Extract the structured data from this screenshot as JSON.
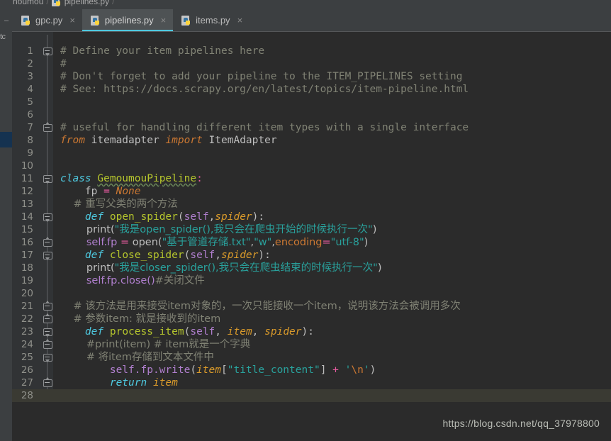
{
  "breadcrumb": {
    "project": "noumou",
    "separator": "/",
    "file": "pipelines.py",
    "trailing_separator": "/"
  },
  "left_rail": {
    "label": "tc"
  },
  "tabs": [
    {
      "label": "gpc.py",
      "icon": "python-file-icon",
      "close": "×",
      "active": false
    },
    {
      "label": "pipelines.py",
      "icon": "python-file-icon",
      "close": "×",
      "active": true
    },
    {
      "label": "items.py",
      "icon": "python-file-icon",
      "close": "×",
      "active": false
    }
  ],
  "editor": {
    "active_line": 28,
    "line_numbers": [
      1,
      2,
      3,
      4,
      5,
      6,
      7,
      8,
      9,
      10,
      11,
      12,
      13,
      14,
      15,
      16,
      17,
      18,
      19,
      20,
      21,
      22,
      23,
      24,
      25,
      26,
      27,
      28
    ],
    "lines": [
      {
        "n": 1,
        "text": "# Define your item pipelines here"
      },
      {
        "n": 2,
        "text": "#"
      },
      {
        "n": 3,
        "text": "# Don't forget to add your pipeline to the ITEM_PIPELINES setting"
      },
      {
        "n": 4,
        "text": "# See: https://docs.scrapy.org/en/latest/topics/item-pipeline.html"
      },
      {
        "n": 5,
        "text": ""
      },
      {
        "n": 6,
        "text": ""
      },
      {
        "n": 7,
        "text": "# useful for handling different item types with a single interface"
      },
      {
        "n": 8,
        "text": "from itemadapter import ItemAdapter"
      },
      {
        "n": 9,
        "text": ""
      },
      {
        "n": 10,
        "text": ""
      },
      {
        "n": 11,
        "text": "class GemoumouPipeline:"
      },
      {
        "n": 12,
        "text": "    fp = None"
      },
      {
        "n": 13,
        "text": "    # 重写父类的两个方法"
      },
      {
        "n": 14,
        "text": "    def open_spider(self,spider):"
      },
      {
        "n": 15,
        "text": "        print(\"我是open_spider(),我只会在爬虫开始的时候执行一次\")"
      },
      {
        "n": 16,
        "text": "        self.fp = open(\"基于管道存储.txt\",\"w\",encoding=\"utf-8\")"
      },
      {
        "n": 17,
        "text": "    def close_spider(self,spider):"
      },
      {
        "n": 18,
        "text": "        print(\"我是closer_spider(),我只会在爬虫结束的时候执行一次\")"
      },
      {
        "n": 19,
        "text": "        self.fp.close()#关闭文件"
      },
      {
        "n": 20,
        "text": ""
      },
      {
        "n": 21,
        "text": "    # 该方法是用来接受item对象的，一次只能接收一个item，说明该方法会被调用多次"
      },
      {
        "n": 22,
        "text": "    # 参数item: 就是接收到的item"
      },
      {
        "n": 23,
        "text": "    def process_item(self, item, spider):"
      },
      {
        "n": 24,
        "text": "        #print(item) # item就是一个字典"
      },
      {
        "n": 25,
        "text": "        # 将item存储到文本文件中"
      },
      {
        "n": 26,
        "text": "        self.fp.write(item[\"title_content\"] + '\\n')"
      },
      {
        "n": 27,
        "text": "        return item"
      },
      {
        "n": 28,
        "text": ""
      }
    ],
    "tokens": {
      "l1_comment": "# Define your item pipelines here",
      "l2_comment": "#",
      "l3_comment": "# Don't forget to add your pipeline to the ITEM_PIPELINES setting",
      "l4_comment": "# See: https://docs.scrapy.org/en/latest/topics/item-pipeline.html",
      "l7_comment": "# useful for handling different item types with a single interface",
      "l8_from": "from",
      "l8_module": " itemadapter ",
      "l8_import": "import",
      "l8_name": " ItemAdapter",
      "l11_class_kw": "class",
      "l11_class_name": "GemoumouPipeline",
      "l11_colon": ":",
      "l12_name": "fp",
      "l12_eq": " = ",
      "l12_none": "None",
      "l13_comment": "# 重写父类的两个方法",
      "l14_def": "def",
      "l14_fn": " open_spider",
      "l14_p1": "(",
      "l14_self": "self",
      "l14_comma": ",",
      "l14_param": "spider",
      "l14_p2": "):",
      "l15_print": "print",
      "l15_paren1": "(",
      "l15_str": "\"我是open_spider(),我只会在爬虫开始的时候执行一次\"",
      "l15_paren2": ")",
      "l16_self": "self",
      "l16_fp": ".fp",
      "l16_eq": " = ",
      "l16_open": "open",
      "l16_paren1": "(",
      "l16_str1": "\"基于管道存储.txt\"",
      "l16_c1": ",",
      "l16_str2": "\"w\"",
      "l16_c2": ",",
      "l16_kwarg": "encoding",
      "l16_eq2": "=",
      "l16_str3": "\"utf-8\"",
      "l16_paren2": ")",
      "l17_def": "def",
      "l17_fn": " close_spider",
      "l17_p1": "(",
      "l17_self": "self",
      "l17_comma": ",",
      "l17_param": "spider",
      "l17_p2": "):",
      "l18_print": "print",
      "l18_paren1": "(",
      "l18_str": "\"我是closer_spider(),我只会在爬虫结束的时候执行一次\"",
      "l18_paren2": ")",
      "l19_self": "self",
      "l19_call": ".fp.close()",
      "l19_comment": "#关闭文件",
      "l21_comment": "# 该方法是用来接受item对象的，一次只能接收一个item，说明该方法会被调用多次",
      "l22_comment": "# 参数item: 就是接收到的item",
      "l23_def": "def",
      "l23_fn": " process_item",
      "l23_p1": "(",
      "l23_self": "self",
      "l23_c1": ", ",
      "l23_item": "item",
      "l23_c2": ", ",
      "l23_spider": "spider",
      "l23_p2": "):",
      "l24_comment": "#print(item) # item就是一个字典",
      "l25_comment": "# 将item存储到文本文件中",
      "l26_self": "self",
      "l26_write": ".fp.write",
      "l26_p1": "(",
      "l26_item": "item",
      "l26_br1": "[",
      "l26_key": "\"title_content\"",
      "l26_br2": "]",
      "l26_plus": " + ",
      "l26_q1": "'",
      "l26_esc": "\\n",
      "l26_q2": "'",
      "l26_p2": ")",
      "l27_return": "return",
      "l27_item": " item"
    }
  },
  "watermark": {
    "text": "https://blog.csdn.net/qq_37978800"
  },
  "colors": {
    "editor_bg": "#2b2b2b",
    "gutter_bg": "#313335",
    "chrome_bg": "#3c3f41",
    "active_tab_bg": "#4e5254",
    "tab_accent": "#4ec9e0",
    "current_line": "#3a3a33",
    "comment": "#808274",
    "keyword": "#4ec9e0",
    "string": "#29a19c",
    "function": "#b5c52d",
    "self": "#b07fce",
    "param": "#d99a2b",
    "orange": "#cc7832",
    "pink": "#e85ba0",
    "rail_marker": "#153250"
  }
}
